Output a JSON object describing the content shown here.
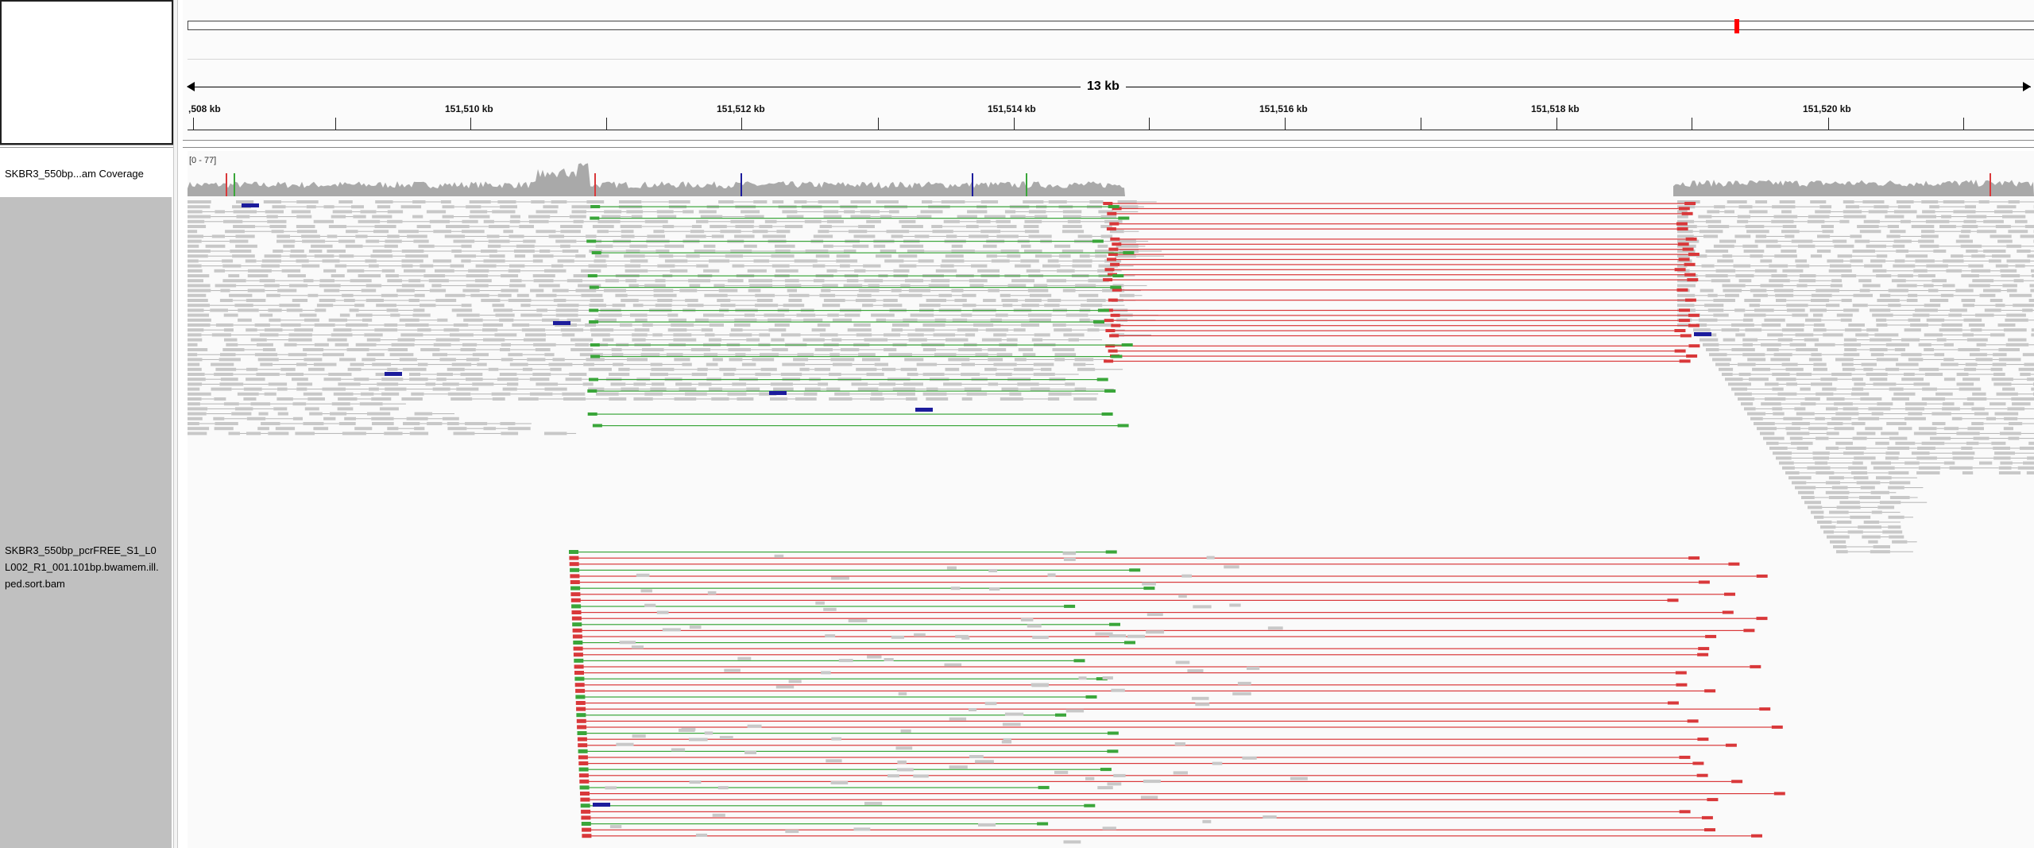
{
  "ruler": {
    "span_label": "13 kb",
    "ticks": [
      {
        "label": ",508 kb"
      },
      {
        "label": "151,510 kb"
      },
      {
        "label": "151,512 kb"
      },
      {
        "label": "151,514 kb"
      },
      {
        "label": "151,516 kb"
      },
      {
        "label": "151,518 kb"
      },
      {
        "label": "151,520 kb"
      }
    ]
  },
  "tracks": {
    "coverage_name": "SKBR3_550bp...am Coverage",
    "coverage_range": "[0 - 77]",
    "alignment_name_lines": [
      "SKBR3_550bp_pcrFREE_S1_L0",
      "L002_R1_001.101bp.bwamem.ill.",
      "ped.sort.bam"
    ]
  },
  "colors": {
    "read": "#c8c8c8",
    "pair_line": "#b4b4b4",
    "deletion_pair": "#d9383a",
    "inversion_pair": "#3aa63a",
    "mismatch_pair": "#1c1c9c",
    "coverage": "#a9a9a9",
    "track_background": "#fafafa"
  }
}
